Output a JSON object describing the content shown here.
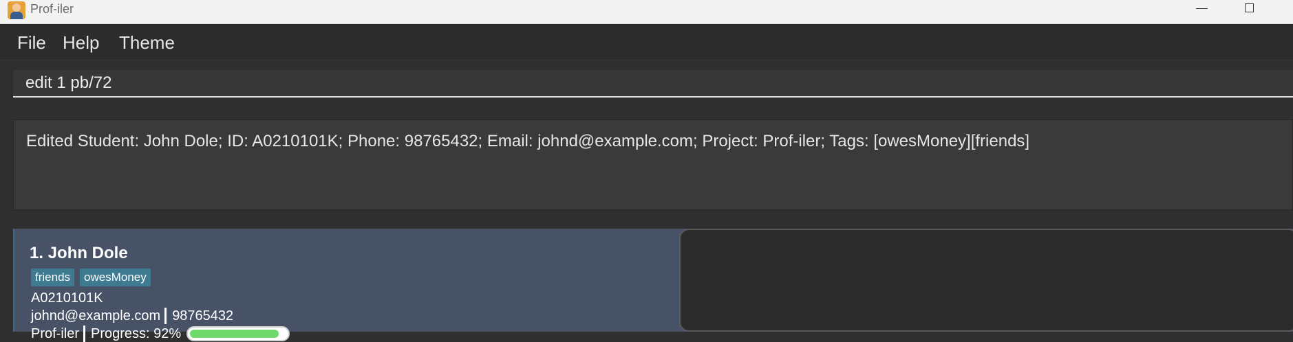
{
  "window": {
    "title": "Prof-iler",
    "icon": "app-avatar-icon"
  },
  "menu": {
    "items": [
      "File",
      "Help",
      "Theme"
    ]
  },
  "command": {
    "value": "edit 1 pb/72"
  },
  "result": {
    "text": "Edited Student: John Dole; ID: A0210101K; Phone: 98765432; Email: johnd@example.com; Project: Prof-iler; Tags: [owesMoney][friends]"
  },
  "students": [
    {
      "name": "1. John Dole",
      "tags": [
        "friends",
        "owesMoney"
      ],
      "id": "A0210101K",
      "email": "johnd@example.com",
      "phone": "98765432",
      "project": "Prof-iler",
      "progress_label": "Progress: 92%",
      "progress": 0.92
    }
  ],
  "colors": {
    "card_bg": "#475267",
    "tag_bg": "#3e7b91",
    "progress_fill": "#6fd96b"
  }
}
